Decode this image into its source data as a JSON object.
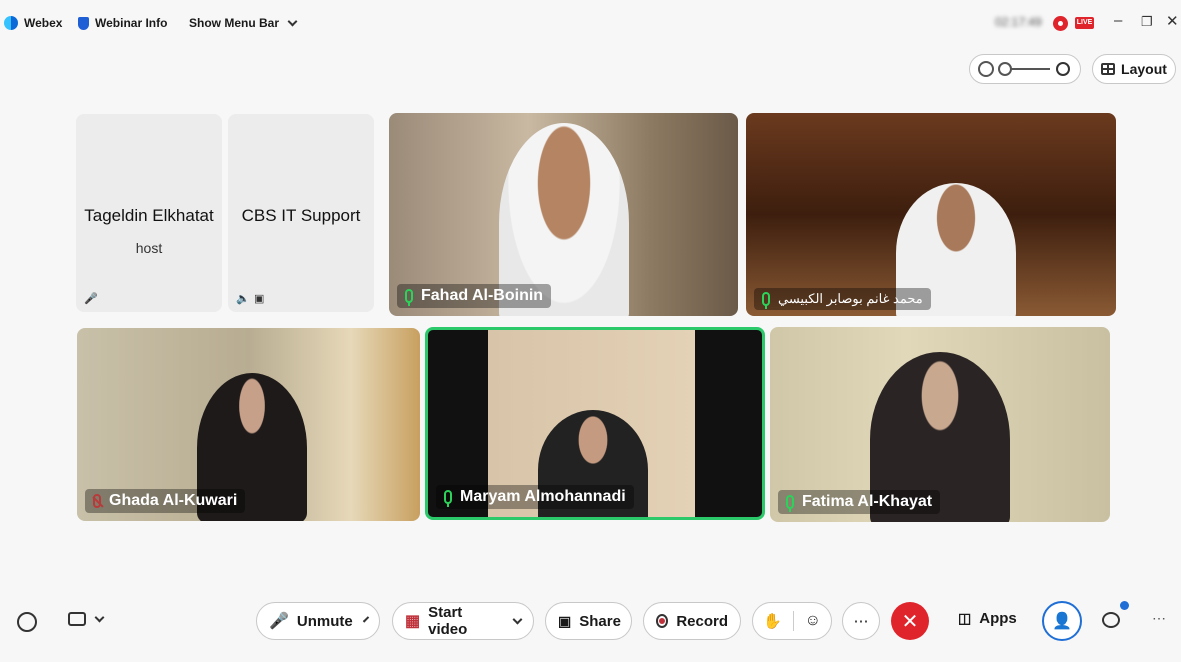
{
  "topbar": {
    "app_name": "Webex",
    "webinar_info": "Webinar Info",
    "show_menu_bar": "Show Menu Bar",
    "timer": "02:17:49",
    "live": "LIVE"
  },
  "controls": {
    "layout": "Layout"
  },
  "participants": [
    {
      "name": "Tageldin Elkhatat",
      "role": "host"
    },
    {
      "name": "CBS IT Support"
    },
    {
      "name": "Fahad Al-Boinin"
    },
    {
      "name": "محمد غانم بوصابر الكبيسي"
    },
    {
      "name": "Ghada Al-Kuwari"
    },
    {
      "name": "Maryam Almohannadi"
    },
    {
      "name": "Fatima Al-Khayat"
    }
  ],
  "toolbar": {
    "unmute": "Unmute",
    "start_video": "Start video",
    "share": "Share",
    "record": "Record",
    "apps": "Apps"
  },
  "colors": {
    "accent_green": "#2cc96a",
    "end_red": "#e0242c",
    "mute_red": "#c0323b"
  }
}
